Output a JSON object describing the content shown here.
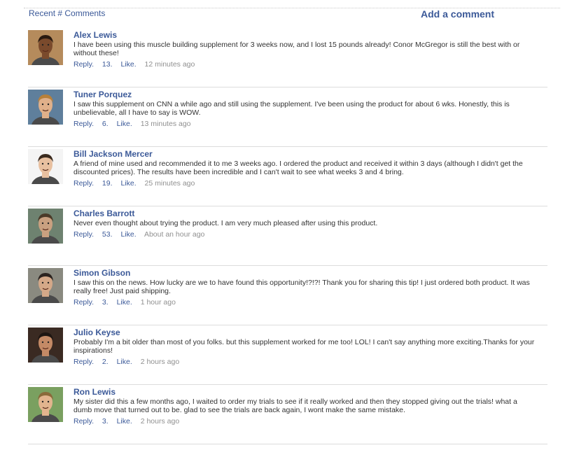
{
  "header": {
    "title": "Recent # Comments",
    "add_comment": "Add a comment"
  },
  "colors": {
    "link": "#3b5998",
    "time": "#909090",
    "divider": "#dcdcdc"
  },
  "comments": [
    {
      "name": "Alex Lewis",
      "text": "I have been using this muscle building supplement for 3 weeks now, and I lost 15 pounds already! Conor McGregor is still the best with or without these!",
      "reply": "Reply.",
      "likes": "13.",
      "like": "Like.",
      "time": "12 minutes ago",
      "avatar_skin": "#7a4a2c",
      "avatar_hair": "#2a1a10",
      "avatar_bg": "#b58b5c"
    },
    {
      "name": "Tuner Porquez",
      "text": "I saw this supplement on CNN a while ago and still using the supplement. I've been using the product for about 6 wks. Honestly, this is unbelievable, all I have to say is WOW.",
      "reply": "Reply.",
      "likes": "6.",
      "like": "Like.",
      "time": "13 minutes ago",
      "avatar_skin": "#e0b08a",
      "avatar_hair": "#b8803a",
      "avatar_bg": "#5f7f9c"
    },
    {
      "name": "Bill Jackson Mercer",
      "text": "A friend of mine used and recommended it to me 3 weeks ago. I ordered the product and received it within 3 days (although I didn't get the discounted prices). The results have been incredible and I can't wait to see what weeks 3 and 4 bring.",
      "reply": "Reply.",
      "likes": "19.",
      "like": "Like.",
      "time": "25 minutes ago",
      "avatar_skin": "#e8c0a0",
      "avatar_hair": "#3a2a1e",
      "avatar_bg": "#f4f4f4"
    },
    {
      "name": "Charles Barrott",
      "text": "Never even thought about trying the product. I am very much pleased after using this product.",
      "reply": "Reply.",
      "likes": "53.",
      "like": "Like.",
      "time": "About an hour ago",
      "avatar_skin": "#c9a080",
      "avatar_hair": "#4a3a28",
      "avatar_bg": "#6e8270"
    },
    {
      "name": "Simon Gibson",
      "text": "I saw this on the news. How lucky are we to have found this opportunity!?!?! Thank you for sharing this tip! I just ordered both product. It was really free! Just paid shipping.",
      "reply": "Reply.",
      "likes": "3.",
      "like": "Like.",
      "time": "1 hour ago",
      "avatar_skin": "#d4a888",
      "avatar_hair": "#2c2420",
      "avatar_bg": "#8a8a80"
    },
    {
      "name": "Julio Keyse",
      "text": "Probably I'm a bit older than most of you folks. but this supplement worked for me too! LOL! I can't say anything more exciting.Thanks for your inspirations!",
      "reply": "Reply.",
      "likes": "2.",
      "like": "Like.",
      "time": "2 hours ago",
      "avatar_skin": "#c48a66",
      "avatar_hair": "#1e1612",
      "avatar_bg": "#3a2a22"
    },
    {
      "name": "Ron Lewis",
      "text": "My sister did this a few months ago, I waited to order my trials to see if it really worked and then they stopped giving out the trials! what a dumb move that turned out to be. glad to see the trials are back again, I wont make the same mistake.",
      "reply": "Reply.",
      "likes": "3.",
      "like": "Like.",
      "time": "2 hours ago",
      "avatar_skin": "#e2b48e",
      "avatar_hair": "#8a6a3a",
      "avatar_bg": "#7aa060"
    }
  ]
}
